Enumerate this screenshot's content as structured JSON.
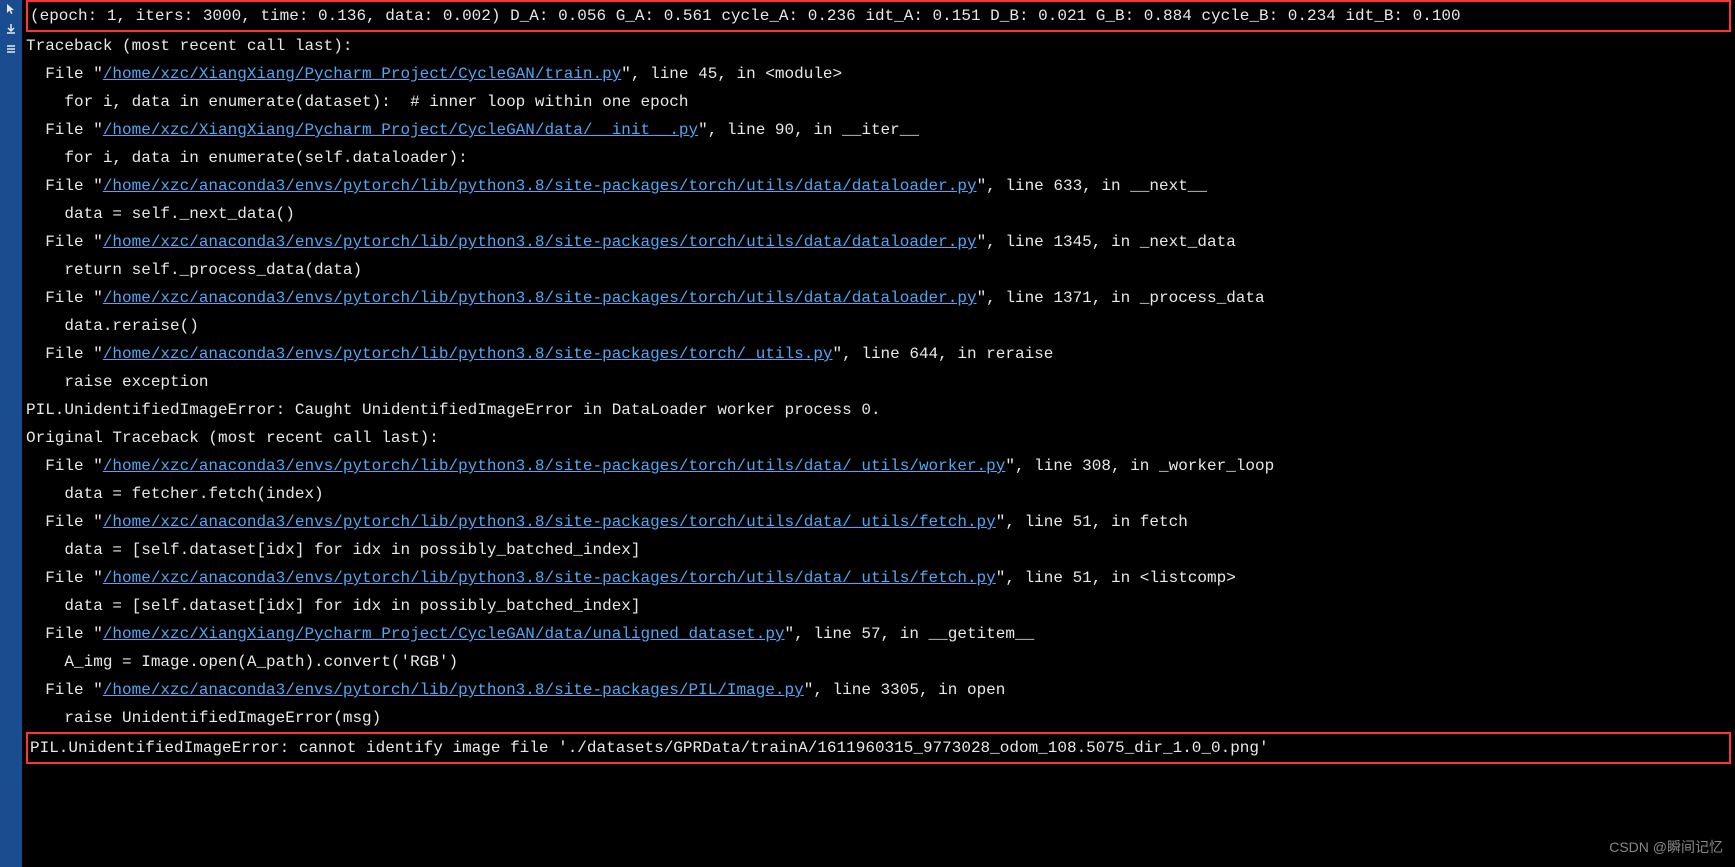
{
  "header_line": "(epoch: 1, iters: 3000, time: 0.136, data: 0.002) D_A: 0.056 G_A: 0.561 cycle_A: 0.236 idt_A: 0.151 D_B: 0.021 G_B: 0.884 cycle_B: 0.234 idt_B: 0.100",
  "traceback_header": "Traceback (most recent call last):",
  "frames": [
    {
      "file_prefix": "  File \"",
      "path": "/home/xzc/XiangXiang/Pycharm_Project/CycleGAN/train.py",
      "suffix": "\", line 45, in <module>",
      "code": "    for i, data in enumerate(dataset):  # inner loop within one epoch"
    },
    {
      "file_prefix": "  File \"",
      "path": "/home/xzc/XiangXiang/Pycharm_Project/CycleGAN/data/__init__.py",
      "suffix": "\", line 90, in __iter__",
      "code": "    for i, data in enumerate(self.dataloader):"
    },
    {
      "file_prefix": "  File \"",
      "path": "/home/xzc/anaconda3/envs/pytorch/lib/python3.8/site-packages/torch/utils/data/dataloader.py",
      "suffix": "\", line 633, in __next__",
      "code": "    data = self._next_data()"
    },
    {
      "file_prefix": "  File \"",
      "path": "/home/xzc/anaconda3/envs/pytorch/lib/python3.8/site-packages/torch/utils/data/dataloader.py",
      "suffix": "\", line 1345, in _next_data",
      "code": "    return self._process_data(data)"
    },
    {
      "file_prefix": "  File \"",
      "path": "/home/xzc/anaconda3/envs/pytorch/lib/python3.8/site-packages/torch/utils/data/dataloader.py",
      "suffix": "\", line 1371, in _process_data",
      "code": "    data.reraise()"
    },
    {
      "file_prefix": "  File \"",
      "path": "/home/xzc/anaconda3/envs/pytorch/lib/python3.8/site-packages/torch/_utils.py",
      "suffix": "\", line 644, in reraise",
      "code": "    raise exception"
    }
  ],
  "error_line_1": "PIL.UnidentifiedImageError: Caught UnidentifiedImageError in DataLoader worker process 0.",
  "original_traceback_header": "Original Traceback (most recent call last):",
  "original_frames": [
    {
      "file_prefix": "  File \"",
      "path": "/home/xzc/anaconda3/envs/pytorch/lib/python3.8/site-packages/torch/utils/data/_utils/worker.py",
      "suffix": "\", line 308, in _worker_loop",
      "code": "    data = fetcher.fetch(index)"
    },
    {
      "file_prefix": "  File \"",
      "path": "/home/xzc/anaconda3/envs/pytorch/lib/python3.8/site-packages/torch/utils/data/_utils/fetch.py",
      "suffix": "\", line 51, in fetch",
      "code": "    data = [self.dataset[idx] for idx in possibly_batched_index]"
    },
    {
      "file_prefix": "  File \"",
      "path": "/home/xzc/anaconda3/envs/pytorch/lib/python3.8/site-packages/torch/utils/data/_utils/fetch.py",
      "suffix": "\", line 51, in <listcomp>",
      "code": "    data = [self.dataset[idx] for idx in possibly_batched_index]"
    },
    {
      "file_prefix": "  File \"",
      "path": "/home/xzc/XiangXiang/Pycharm_Project/CycleGAN/data/unaligned_dataset.py",
      "suffix": "\", line 57, in __getitem__",
      "code": "    A_img = Image.open(A_path).convert('RGB')"
    },
    {
      "file_prefix": "  File \"",
      "path": "/home/xzc/anaconda3/envs/pytorch/lib/python3.8/site-packages/PIL/Image.py",
      "suffix": "\", line 3305, in open",
      "code": "    raise UnidentifiedImageError(msg)"
    }
  ],
  "final_error": "PIL.UnidentifiedImageError: cannot identify image file './datasets/GPRData/trainA/1611960315_9773028_odom_108.5075_dir_1.0_0.png'",
  "watermark": "CSDN @瞬间记忆"
}
